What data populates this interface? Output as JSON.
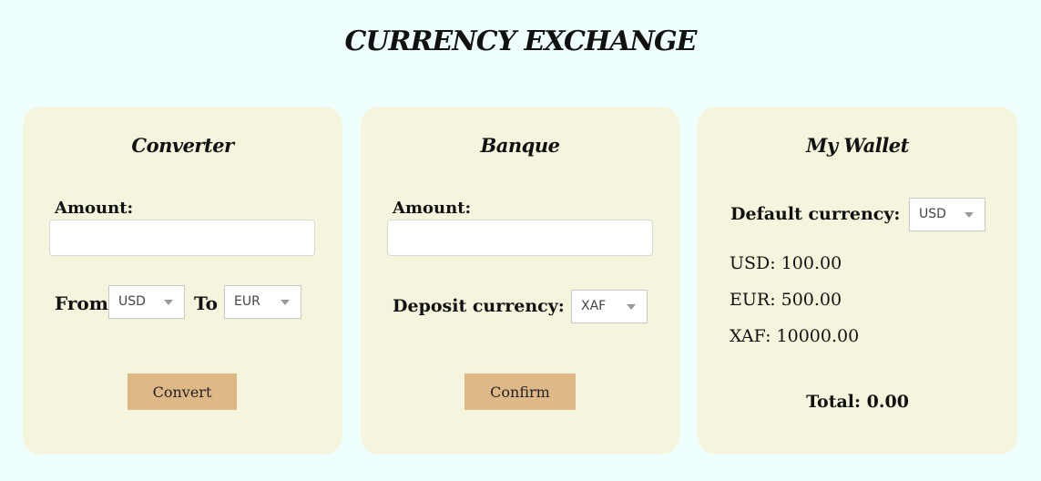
{
  "title": "CURRENCY EXCHANGE",
  "converter": {
    "title": "Converter",
    "amount_label": "Amount:",
    "amount_value": "",
    "from_label": "From",
    "from_value": "USD",
    "to_label": "To",
    "to_value": "EUR",
    "convert_label": "Convert"
  },
  "banque": {
    "title": "Banque",
    "amount_label": "Amount:",
    "amount_value": "",
    "deposit_label": "Deposit currency:",
    "deposit_value": "XAF",
    "confirm_label": "Confirm"
  },
  "wallet": {
    "title": "My Wallet",
    "default_label": "Default currency:",
    "default_value": "USD",
    "balances": [
      "USD: 100.00",
      "EUR: 500.00",
      "XAF: 10000.00"
    ],
    "total": "Total: 0.00"
  },
  "colors": {
    "page_bg": "#eefffe",
    "card_bg": "#f5f4dc",
    "button_bg": "#deb887"
  }
}
